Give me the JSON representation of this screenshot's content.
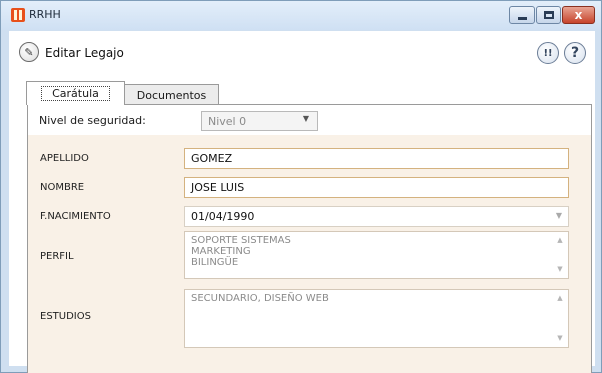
{
  "window": {
    "title": "RRHH",
    "buttons": {
      "minimize_icon": "minimize-icon",
      "maximize_icon": "maximize-icon",
      "close_glyph": "x"
    }
  },
  "header": {
    "action_label": "Editar Legajo",
    "action_icon": "edit-pencil-icon",
    "news_icon_text": "!!",
    "help_icon_text": "?"
  },
  "tabs": [
    {
      "label": "Carátula",
      "active": true
    },
    {
      "label": "Documentos",
      "active": false
    }
  ],
  "form": {
    "nivel": {
      "label": "Nivel de seguridad:",
      "value": "Nivel 0",
      "enabled": false
    },
    "apellido": {
      "label": "APELLIDO",
      "value": "GOMEZ"
    },
    "nombre": {
      "label": "NOMBRE",
      "value": "JOSE LUIS"
    },
    "nacimiento": {
      "label": "F.NACIMIENTO",
      "value": "01/04/1990"
    },
    "perfil": {
      "label": "PERFIL",
      "lines": [
        "SOPORTE SISTEMAS",
        "MARKETING",
        "BILINGÜE"
      ]
    },
    "estudios": {
      "label": "ESTUDIOS",
      "lines": [
        "SECUNDARIO, DISEÑO WEB"
      ]
    }
  },
  "colors": {
    "panel_bg": "#f9f1e7",
    "textbox_border": "#d4b27f",
    "window_frame": "#cfdff0"
  }
}
